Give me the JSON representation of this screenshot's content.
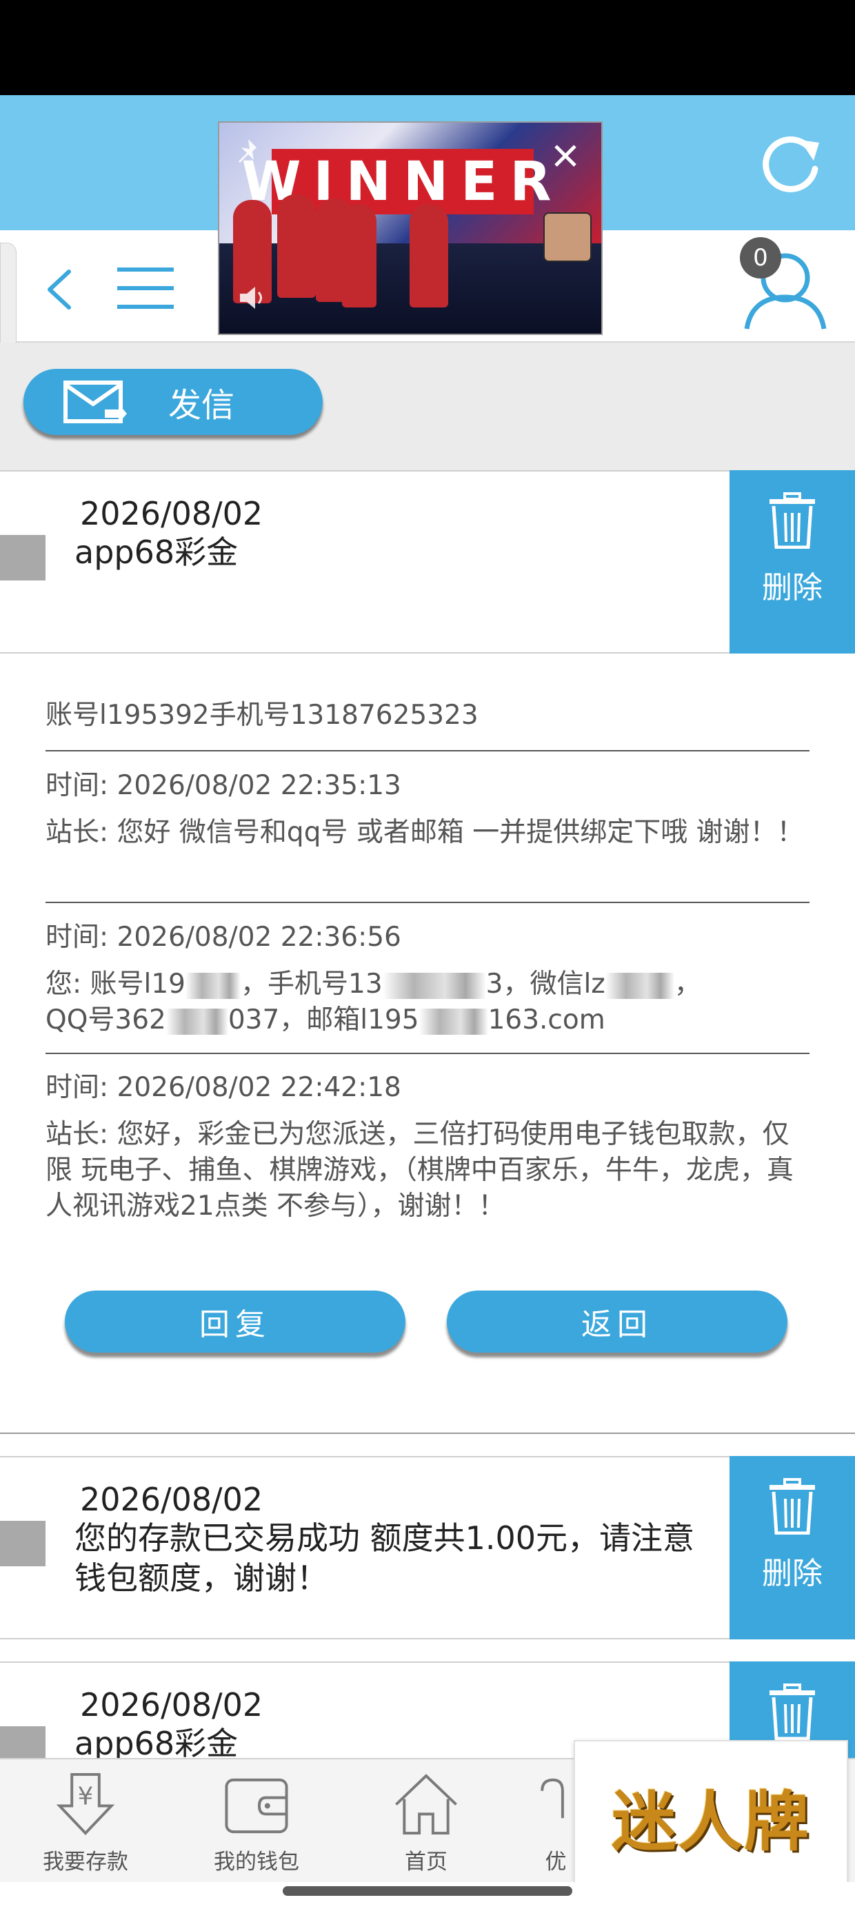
{
  "header": {
    "badge_count": "0"
  },
  "video": {
    "banner_text": "WINNER"
  },
  "compose": {
    "label": "发信"
  },
  "messages": [
    {
      "date": "2026/08/02",
      "title": "app68彩金",
      "delete_label": "删除"
    },
    {
      "date": "2026/08/02",
      "title": "您的存款已交易成功 额度共1.00元，请注意钱包额度，谢谢！",
      "delete_label": "删除"
    },
    {
      "date": "2026/08/02",
      "title": "app68彩金",
      "delete_label": "删除"
    }
  ],
  "detail": {
    "subject": "账号l195392手机号13187625323",
    "entries": [
      {
        "time": "时间: 2026/08/02 22:35:13",
        "text": "站长: 您好 微信号和qq号 或者邮箱 一并提供绑定下哦 谢谢！！"
      },
      {
        "time": "时间: 2026/08/02 22:36:56",
        "line1_a": "您: 账号l19",
        "line1_b": "，手机号13",
        "line1_c": "3，微信lz",
        "line1_d": "，",
        "line2_a": "QQ号362",
        "line2_b": "037，邮箱l195",
        "line2_c": "163.com"
      },
      {
        "time": "时间: 2026/08/02 22:42:18",
        "text": "站长: 您好，彩金已为您派送，三倍打码使用电子钱包取款，仅限 玩电子、捕鱼、棋牌游戏，（棋牌中百家乐，牛牛，龙虎，真人视讯游戏21点类 不参与），谢谢！！"
      }
    ],
    "reply_label": "回复",
    "back_label": "返回"
  },
  "tabs": [
    {
      "label": "我要存款",
      "icon": "deposit-icon"
    },
    {
      "label": "我的钱包",
      "icon": "wallet-icon"
    },
    {
      "label": "首页",
      "icon": "home-icon"
    },
    {
      "label": "优",
      "icon": "promo-icon"
    }
  ],
  "brand": {
    "text": "迷人牌"
  },
  "colors": {
    "accent": "#3ba7dc",
    "header": "#72c8ef"
  }
}
